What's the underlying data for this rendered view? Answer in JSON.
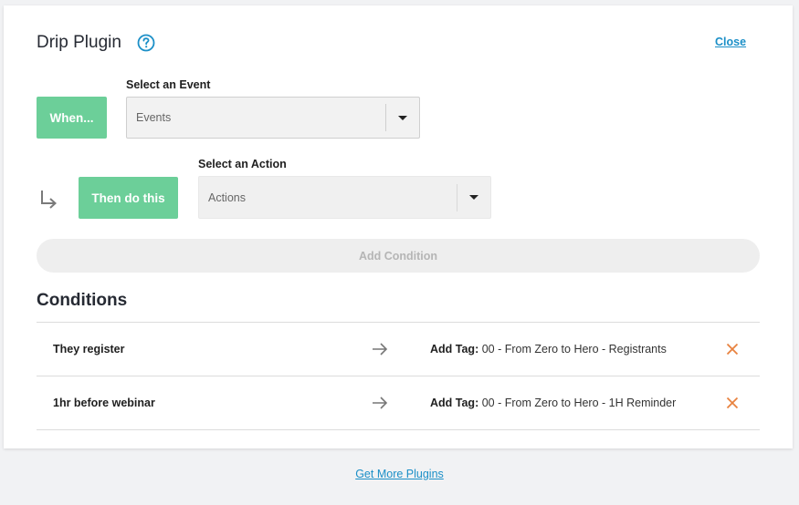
{
  "header": {
    "title": "Drip Plugin",
    "close_label": "Close"
  },
  "when_block": {
    "button_label": "When...",
    "field_label": "Select an Event",
    "select_value": "Events"
  },
  "then_block": {
    "button_label": "Then do this",
    "field_label": "Select an Action",
    "select_value": "Actions"
  },
  "add_condition_label": "Add Condition",
  "conditions": {
    "title": "Conditions",
    "rows": [
      {
        "trigger": "They register",
        "action_prefix": "Add Tag:",
        "action_value": "00 - From Zero to Hero - Registrants"
      },
      {
        "trigger": "1hr before webinar",
        "action_prefix": "Add Tag:",
        "action_value": "00 - From Zero to Hero - 1H Reminder"
      }
    ]
  },
  "footer_link": "Get More Plugins",
  "colors": {
    "accent_green": "#6ccf99",
    "link_blue": "#1b8fc7",
    "remove_orange": "#e8823f"
  },
  "icons": {
    "help": "help-circle-icon",
    "turn": "turn-down-right-icon",
    "arrow": "arrow-right-icon",
    "remove": "close-x-icon",
    "caret": "caret-down-icon"
  }
}
